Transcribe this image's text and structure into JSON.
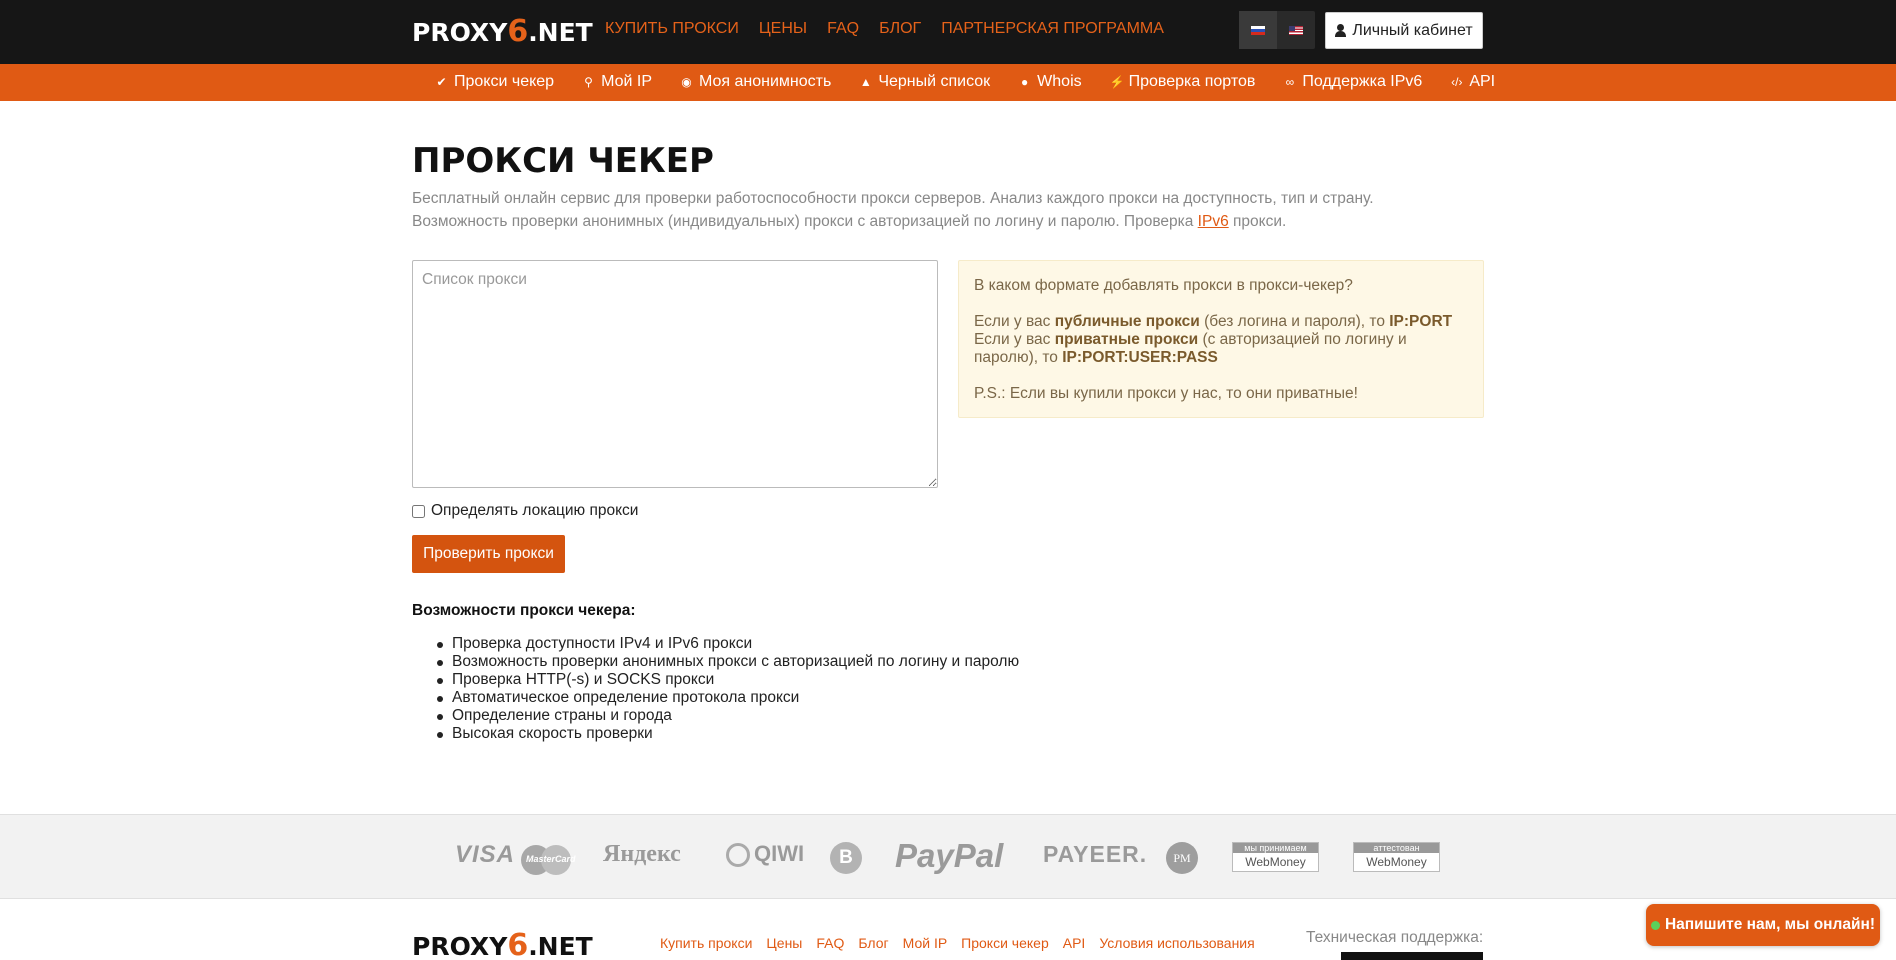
{
  "header": {
    "logo_pre": "PROXY",
    "logo_six": "6",
    "logo_post": ".NET",
    "nav": [
      {
        "label": "КУПИТЬ ПРОКСИ"
      },
      {
        "label": "ЦЕНЫ"
      },
      {
        "label": "FAQ"
      },
      {
        "label": "БЛОГ"
      },
      {
        "label": "ПАРТНЕРСКАЯ ПРОГРАММА"
      }
    ],
    "languages": [
      {
        "icon": "flag-ru-icon",
        "active": true
      },
      {
        "icon": "flag-us-icon",
        "active": false
      }
    ],
    "cabinet_label": "Личный кабинет",
    "cabinet_icon": "user-icon"
  },
  "subnav": [
    {
      "label": "Прокси чекер",
      "icon": "check-circle-icon"
    },
    {
      "label": "Мой IP",
      "icon": "map-marker-icon"
    },
    {
      "label": "Моя анонимность",
      "icon": "eye-icon"
    },
    {
      "label": "Черный список",
      "icon": "warning-icon"
    },
    {
      "label": "Whois",
      "icon": "globe-icon"
    },
    {
      "label": "Проверка портов",
      "icon": "plug-icon"
    },
    {
      "label": "Поддержка IPv6",
      "icon": "link-icon"
    },
    {
      "label": "API",
      "icon": "code-icon"
    }
  ],
  "page": {
    "title": "ПРОКСИ ЧЕКЕР",
    "lead_line1": "Бесплатный онлайн сервис для проверки работоспособности прокси серверов. Анализ каждого прокси на доступность, тип и страну.",
    "lead_line2_pre": "Возможность проверки анонимных (индивидуальных) прокси с авторизацией по логину и паролю. Проверка ",
    "lead_line2_link": "IPv6",
    "lead_line2_post": " прокси."
  },
  "form": {
    "proxies_placeholder": "Список прокси",
    "proxies_value": "",
    "location_label": "Определять локацию прокси",
    "location_checked": false,
    "submit_label": "Проверить прокси"
  },
  "hint": {
    "question": "В каком формате добавлять прокси в прокси-чекер?",
    "public_pre": "Если у вас ",
    "public_bold": "публичные прокси",
    "public_mid": " (без логина и пароля), то ",
    "public_format": "IP:PORT",
    "private_pre": "Если у вас ",
    "private_bold": "приватные прокси",
    "private_mid": " (с авторизацией по логину и паролю), то ",
    "private_format": "IP:PORT:USER:PASS",
    "ps": "P.S.: Если вы купили прокси у нас, то они приватные!"
  },
  "features": {
    "title": "Возможности прокси чекера:",
    "items": [
      "Проверка доступности IPv4 и IPv6 прокси",
      "Возможность проверки анонимных прокси с авторизацией по логину и паролю",
      "Проверка HTTP(-s) и SOCKS прокси",
      "Автоматическое определение протокола прокси",
      "Определение страны и города",
      "Высокая скорость проверки"
    ]
  },
  "payments": {
    "visa": "VISA",
    "mastercard": "MasterCard",
    "yandex": "Яндекс",
    "qiwi": "QIWI",
    "bitcoin": "B",
    "paypal": "PayPal",
    "payeer": "PAYEER.",
    "pm": "PM",
    "wm_accept_top": "мы принимаем",
    "wm_accept_bottom": "WebMoney",
    "wm_cert_top": "аттестован",
    "wm_cert_bottom": "WebMoney"
  },
  "footer": {
    "logo_pre": "PROXY",
    "logo_six": "6",
    "logo_post": ".NET",
    "links": [
      {
        "label": "Купить прокси"
      },
      {
        "label": "Цены"
      },
      {
        "label": "FAQ"
      },
      {
        "label": "Блог"
      },
      {
        "label": "Мой IP"
      },
      {
        "label": "Прокси чекер"
      },
      {
        "label": "API"
      },
      {
        "label": "Условия использования"
      }
    ],
    "support_label": "Техническая поддержка:"
  },
  "chat": {
    "label": "Напишите нам, мы онлайн!",
    "status_color": "#5bd05b"
  },
  "colors": {
    "accent": "#e05a14",
    "header_bg": "#161616",
    "hint_bg": "#fef8e6"
  }
}
